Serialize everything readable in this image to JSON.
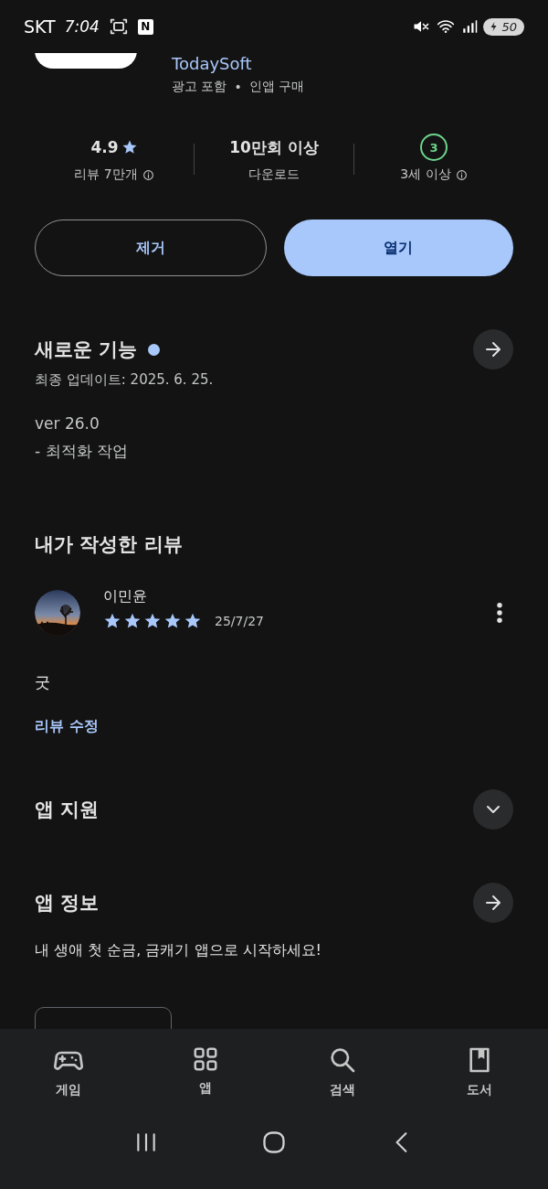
{
  "status_bar": {
    "carrier": "SKT",
    "time": "7:04",
    "notification_badge": "N",
    "battery": "50"
  },
  "app_header": {
    "developer": "TodaySoft",
    "tags": [
      "광고 포함",
      "인앱 구매"
    ],
    "separator": "•"
  },
  "stats": [
    {
      "kind": "rating",
      "value": "4.9",
      "label": "리뷰 7만개",
      "info": true
    },
    {
      "kind": "text",
      "value": "10만회 이상",
      "label": "다운로드",
      "info": false
    },
    {
      "kind": "age",
      "value": "3",
      "label": "3세 이상",
      "info": true
    }
  ],
  "buttons": [
    {
      "label": "제거",
      "kind": "outlined"
    },
    {
      "label": "열기",
      "kind": "filled"
    }
  ],
  "whats_new": {
    "title": "새로운 기능",
    "new_dot": true,
    "updated": "최종 업데이트: 2025. 6. 25.",
    "notes": [
      "ver 26.0",
      "- 최적화 작업"
    ]
  },
  "my_review": {
    "title": "내가 작성한 리뷰",
    "author": "이민윤",
    "stars": 5,
    "date": "25/7/27",
    "text": "굿",
    "edit_link": "리뷰 수정"
  },
  "sections": [
    {
      "title": "앱 지원",
      "kind": "expand"
    },
    {
      "title": "앱 정보",
      "kind": "navigate",
      "description": "내 생애 첫 순금, 금캐기 앱으로 시작하세요!"
    }
  ],
  "bottom_nav": [
    {
      "label": "게임",
      "selected": false
    },
    {
      "label": "앱",
      "selected": false
    },
    {
      "label": "검색",
      "selected": false
    },
    {
      "label": "도서",
      "selected": false
    }
  ]
}
